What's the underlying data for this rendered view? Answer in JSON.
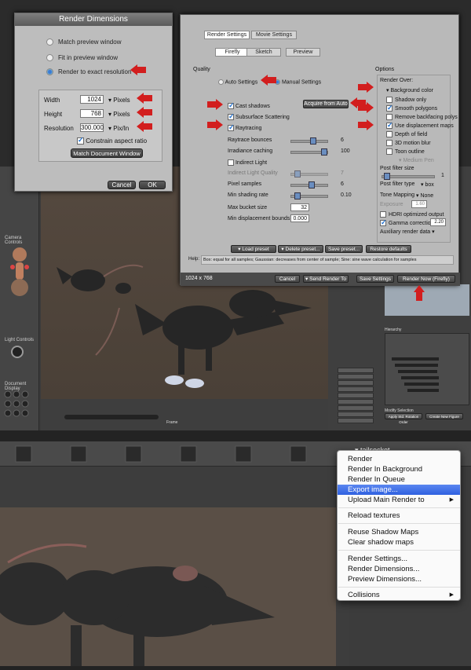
{
  "render_dimensions": {
    "title": "Render Dimensions",
    "options": [
      "Match preview window",
      "Fit in preview window",
      "Render to exact resolution"
    ],
    "selected_option": 2,
    "width_label": "Width",
    "width_value": "1024",
    "width_unit": "Pixels",
    "height_label": "Height",
    "height_value": "768",
    "height_unit": "Pixels",
    "resolution_label": "Resolution",
    "resolution_value": "300.000",
    "resolution_unit": "Pix/In",
    "constrain_label": "Constrain aspect ratio",
    "match_button": "Match Document Window",
    "cancel": "Cancel",
    "ok": "OK"
  },
  "render_settings": {
    "tabs": [
      "Render Settings",
      "Movie Settings"
    ],
    "subtabs": [
      "Firefly",
      "Sketch",
      "Preview"
    ],
    "quality_label": "Quality",
    "auto_settings": "Auto Settings",
    "manual_settings": "Manual Settings",
    "cast_shadows": "Cast shadows",
    "acquire_button": "Acquire from Auto",
    "subsurface": "Subsurface Scattering",
    "raytracing": "Raytracing",
    "raytrace_bounces": "Raytrace bounces",
    "raytrace_bounces_val": "6",
    "irradiance": "Irradiance caching",
    "irradiance_val": "100",
    "indirect_light": "Indirect Light",
    "indirect_quality": "Indirect Light Quality",
    "indirect_quality_val": "7",
    "pixel_samples": "Pixel samples",
    "pixel_samples_val": "6",
    "min_shading": "Min shading rate",
    "min_shading_val": "0.10",
    "max_bucket": "Max bucket size",
    "max_bucket_val": "32",
    "min_disp": "Min displacement bounds",
    "min_disp_val": "0.000",
    "options_label": "Options",
    "render_over": "Render Over:",
    "background_color": "Background color",
    "shadow_only": "Shadow only",
    "smooth_polygons": "Smooth polygons",
    "remove_backfacing": "Remove backfacing polys",
    "use_displacement": "Use displacement maps",
    "depth_of_field": "Depth of field",
    "motion_blur": "3D motion blur",
    "toon_outline": "Toon outline",
    "medium_pen": "Medium Pen",
    "post_filter_size": "Post filter size",
    "post_filter_size_val": "1",
    "post_filter_type": "Post filter type",
    "post_filter_type_val": "box",
    "tone_mapping": "Tone Mapping",
    "tone_mapping_val": "None",
    "exposure": "Exposure",
    "exposure_val": "1.60",
    "hdri": "HDRI optimized output",
    "gamma": "Gamma correction",
    "gamma_val": "2.20",
    "aux": "Auxiliary render data",
    "load_preset": "Load preset",
    "delete_preset": "Delete preset...",
    "save_preset": "Save preset...",
    "restore": "Restore defaults",
    "help_label": "Help:",
    "help_text": "Box: equal for all samples; Gaussian: decreases from center of sample; Sine: sine wave calculation for samples",
    "size_readout": "1024 x 768",
    "cancel": "Cancel",
    "send_render": "Send Render To",
    "save_settings": "Save Settings",
    "render_now": "Render Now (Firefly)"
  },
  "app": {
    "camera_controls": "Camera Controls",
    "light_controls": "Light Controls",
    "document_display": "Document Display",
    "hierarchy": "Hierarchy",
    "modify_selection": "Modify Selection",
    "apply_button": "Apply Std. Rotation Order",
    "create_figure": "Create New Figure",
    "frame_label": "Frame"
  },
  "context_menu": {
    "header": "tailsocket",
    "items": [
      "Render",
      "Render In Background",
      "Render In Queue",
      "Export image...",
      "Upload Main Render to",
      "Reload textures",
      "Reuse Shadow Maps",
      "Clear shadow maps",
      "Render Settings...",
      "Render Dimensions...",
      "Preview Dimensions...",
      "Collisions"
    ],
    "highlighted": "Export image..."
  },
  "colors": {
    "accent": "#d21e1e",
    "highlight": "#3a6ae8"
  }
}
